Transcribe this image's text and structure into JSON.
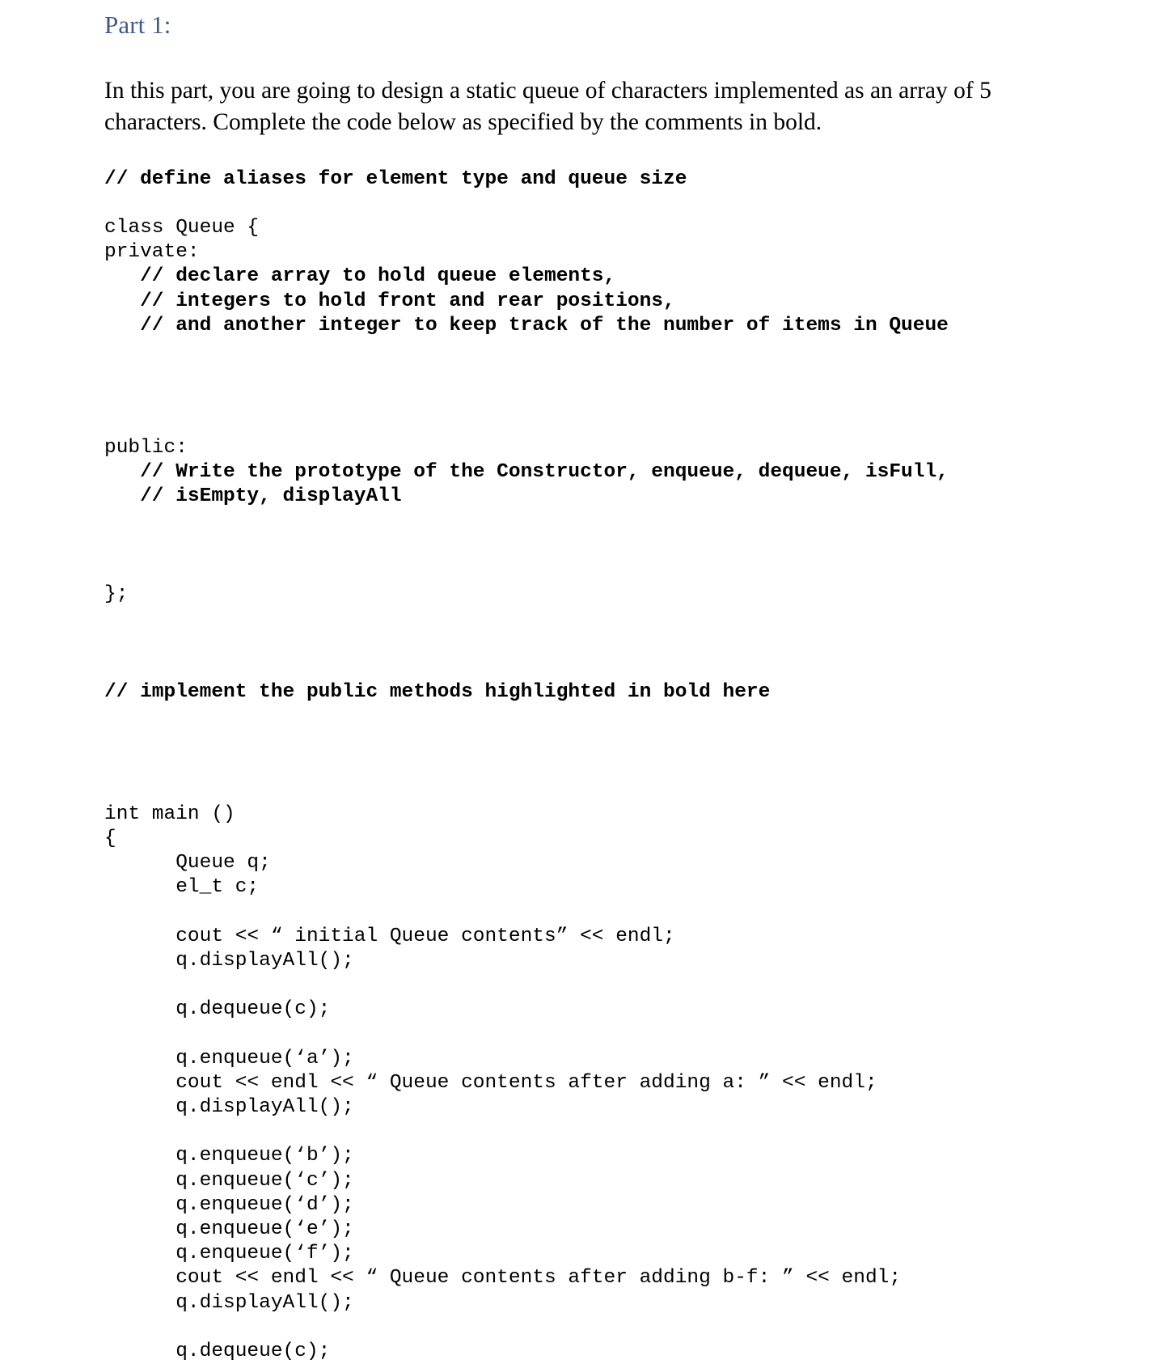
{
  "document": {
    "heading": "Part 1:",
    "heading_color": "#3e5a8b",
    "intro_paragraph": "In this part, you are going to design a static queue of characters implemented as an array of 5 characters. Complete the code below as specified by the comments in bold."
  },
  "code": {
    "comment_1": "// define aliases for element type and queue size",
    "class_decl": "class Queue {",
    "private_label": "private:",
    "comment_private_1": "   // declare array to hold queue elements,",
    "comment_private_2": "   // integers to hold front and rear positions,",
    "comment_private_3": "   // and another integer to keep track of the number of items in Queue",
    "public_label": "public:",
    "comment_public_1": "   // Write the prototype of the Constructor, enqueue, dequeue, isFull,",
    "comment_public_2": "   // isEmpty, displayAll",
    "class_end": "};",
    "comment_implement": "// implement the public methods highlighted in bold here",
    "main_signature": "int main ()",
    "main_open_brace": "{",
    "decl_queue": "      Queue q;",
    "decl_elt": "      el_t c;",
    "cout_initial": "      cout << “ initial Queue contents” << endl;",
    "display_1": "      q.displayAll();",
    "dequeue_1": "      q.dequeue(c);",
    "enqueue_a": "      q.enqueue(‘a’);",
    "cout_after_a": "      cout << endl << “ Queue contents after adding a: ” << endl;",
    "display_2": "      q.displayAll();",
    "enqueue_b": "      q.enqueue(‘b’);",
    "enqueue_c": "      q.enqueue(‘c’);",
    "enqueue_d": "      q.enqueue(‘d’);",
    "enqueue_e": "      q.enqueue(‘e’);",
    "enqueue_f": "      q.enqueue(‘f’);",
    "cout_after_bf": "      cout << endl << “ Queue contents after adding b-f: ” << endl;",
    "display_3": "      q.displayAll();",
    "dequeue_2": "      q.dequeue(c);"
  }
}
